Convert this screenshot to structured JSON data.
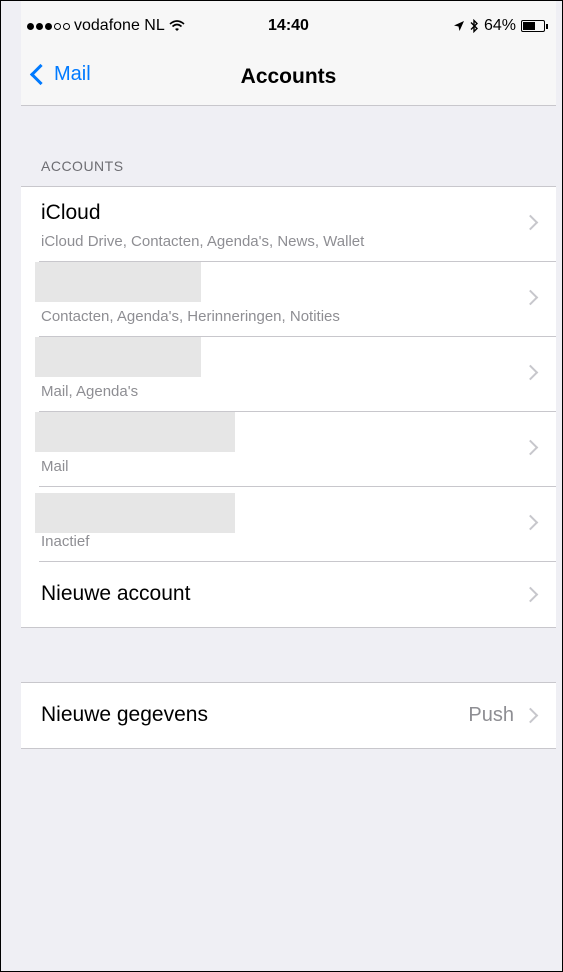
{
  "status_bar": {
    "carrier": "vodafone NL",
    "time": "14:40",
    "battery": "64%",
    "battery_level": 0.64
  },
  "nav": {
    "back_label": "Mail",
    "title": "Accounts"
  },
  "accounts_section": {
    "header": "ACCOUNTS",
    "rows": [
      {
        "title": "iCloud",
        "subtitle": "iCloud Drive, Contacten, Agenda's, News, Wallet"
      },
      {
        "title": "",
        "subtitle": "Contacten, Agenda's, Herinneringen, Notities"
      },
      {
        "title": "",
        "subtitle": "Mail, Agenda's"
      },
      {
        "title": "",
        "subtitle": "Mail"
      },
      {
        "title": "",
        "subtitle": "Inactief"
      },
      {
        "title": "Nieuwe account",
        "subtitle": ""
      }
    ]
  },
  "fetch_section": {
    "title": "Nieuwe gegevens",
    "detail": "Push"
  },
  "colors": {
    "accent": "#007aff",
    "background": "#efeff4",
    "separator": "#c8c7cc",
    "secondary_text": "#8e8e93"
  }
}
